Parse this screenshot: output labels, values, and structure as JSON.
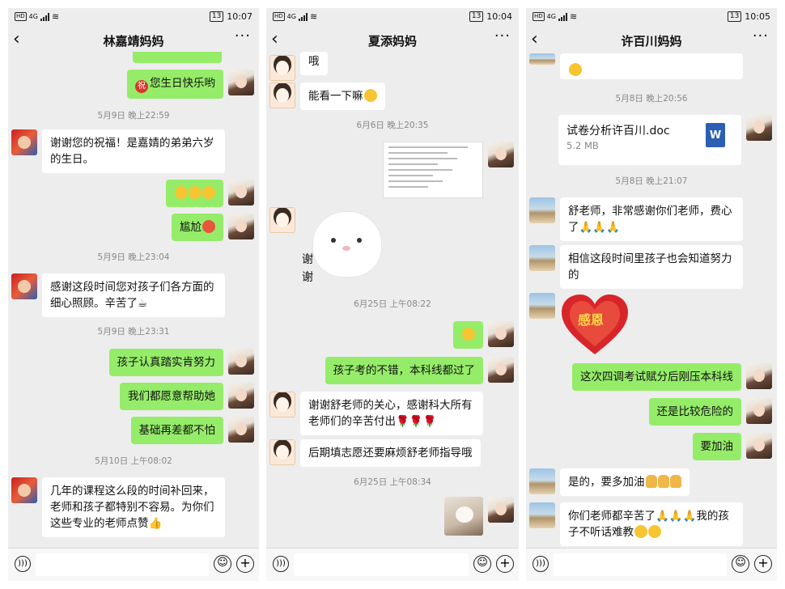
{
  "status_bars": [
    {
      "network": "4G",
      "battery": "13",
      "time": "10:07"
    },
    {
      "network": "4G",
      "battery": "13",
      "time": "10:04"
    },
    {
      "network": "4G",
      "battery": "13",
      "time": "10:05"
    }
  ],
  "panel1": {
    "title": "林嘉靖妈妈",
    "m1": "您生日快乐哟",
    "m1_badge": "祝",
    "t1": "5月9日 晚上22:59",
    "m2": "谢谢您的祝福！是嘉婧的弟弟六岁的生日。",
    "m4": "尴尬",
    "t2": "5月9日 晚上23:04",
    "m5": "感谢这段时间您对孩子们各方面的细心照顾。辛苦了☕",
    "t3": "5月9日 晚上23:31",
    "m6": "孩子认真踏实肯努力",
    "m7": "我们都愿意帮助她",
    "m8": "基础再差都不怕",
    "t4": "5月10日 上午08:02",
    "m9": "几年的课程这么段的时间补回来，老师和孩子都特别不容易。为你们这些专业的老师点赞👍"
  },
  "panel2": {
    "title": "夏添妈妈",
    "m0": "哦",
    "m1": "能看一下嘛",
    "t1": "6月6日 晚上20:35",
    "sticker_text_1": "谢",
    "sticker_text_2": "谢",
    "t2": "6月25日 上午08:22",
    "m3": "孩子考的不错，本科线都过了",
    "m4": "谢谢舒老师的关心，感谢科大所有老师们的辛苦付出🌹🌹🌹",
    "m5": "后期填志愿还要麻烦舒老师指导哦",
    "t3": "6月25日 上午08:34"
  },
  "panel3": {
    "title": "许百川妈妈",
    "t1": "5月8日 晚上20:56",
    "doc_name": "试卷分析许百川.doc",
    "doc_size": "5.2 MB",
    "doc_icon": "W",
    "t2": "5月8日 晚上21:07",
    "m1": "舒老师，非常感谢你们老师，费心了🙏🙏🙏",
    "m2": "相信这段时间里孩子也会知道努力的",
    "heart_text": "感恩",
    "m3": "这次四调考试赋分后刚压本科线",
    "m4": "还是比较危险的",
    "m5": "要加油",
    "m6": "是的，要多加油",
    "m7": "你们老师都辛苦了🙏🙏🙏我的孩子不听话难教"
  },
  "icons": {
    "voice": "voice-icon",
    "emoji": "emoji-icon",
    "plus": "plus-icon",
    "back": "back-arrow-icon",
    "more": "more-icon"
  }
}
